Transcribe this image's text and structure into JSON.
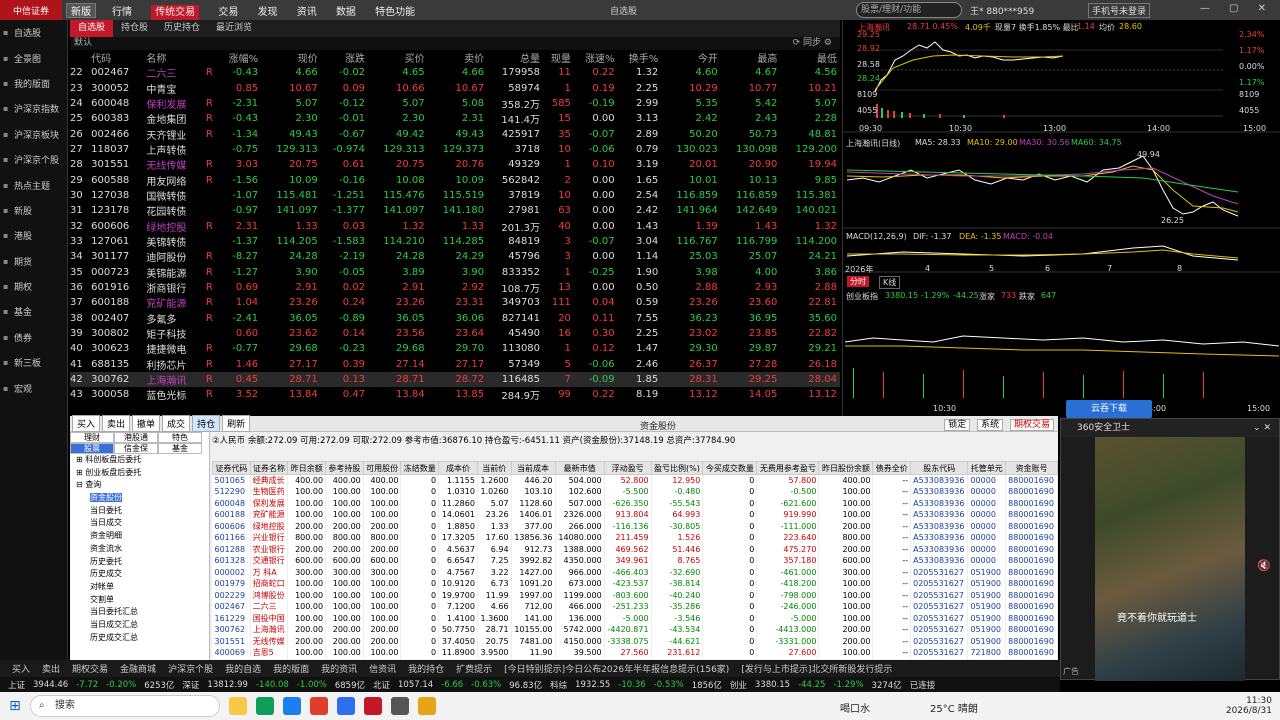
{
  "app": {
    "broker": "中信证券",
    "version_select": "新版",
    "menu": [
      "行情",
      "传统交易",
      "交易",
      "发现",
      "资讯",
      "数据",
      "特色功能"
    ],
    "active_menu": "传统交易",
    "window_title": "自选股",
    "search_placeholder": "股票/理财/功能",
    "user": "王* 880***959",
    "phone_login": "手机号未登录"
  },
  "left_nav": [
    "自选股",
    "全景图",
    "我的版面",
    "沪深京指数",
    "沪深京板块",
    "沪深京个股",
    "热点主题",
    "新股",
    "港股",
    "期货",
    "期权",
    "基金",
    "债券",
    "新三板",
    "宏观"
  ],
  "sub_tabs": [
    "自选股",
    "持仓股",
    "历史持仓",
    "最近浏览"
  ],
  "default_label": "默认",
  "sync_label": "同步",
  "quote_columns": [
    "",
    "代码",
    "名称",
    "",
    "涨幅%",
    "现价",
    "涨跌",
    "买价",
    "卖价",
    "总量",
    "现量",
    "涨速%",
    "换手%",
    "今开",
    "最高",
    "最低"
  ],
  "quotes": [
    [
      "22",
      "002467",
      "二六三",
      "R",
      "-0.43",
      "4.66",
      "-0.02",
      "4.65",
      "4.66",
      "179958",
      "11",
      "0.22",
      "1.32",
      "4.60",
      "4.67",
      "4.56"
    ],
    [
      "23",
      "300052",
      "中青宝",
      "",
      "0.85",
      "10.67",
      "0.09",
      "10.66",
      "10.67",
      "58974",
      "1",
      "0.19",
      "2.25",
      "10.29",
      "10.77",
      "10.21"
    ],
    [
      "24",
      "600048",
      "保利发展",
      "R",
      "-2.31",
      "5.07",
      "-0.12",
      "5.07",
      "5.08",
      "358.2万",
      "585",
      "-0.19",
      "2.99",
      "5.35",
      "5.42",
      "5.07"
    ],
    [
      "25",
      "600383",
      "金地集团",
      "R",
      "-0.43",
      "2.30",
      "-0.01",
      "2.30",
      "2.31",
      "141.4万",
      "15",
      "0.00",
      "3.13",
      "2.42",
      "2.43",
      "2.28"
    ],
    [
      "26",
      "002466",
      "天齐锂业",
      "R",
      "-1.34",
      "49.43",
      "-0.67",
      "49.42",
      "49.43",
      "425917",
      "35",
      "-0.07",
      "2.89",
      "50.20",
      "50.73",
      "48.81"
    ],
    [
      "27",
      "118037",
      "上声转债",
      "",
      "-0.75",
      "129.313",
      "-0.974",
      "129.313",
      "129.373",
      "3718",
      "10",
      "-0.06",
      "0.79",
      "130.023",
      "130.098",
      "129.200"
    ],
    [
      "28",
      "301551",
      "无线传媒",
      "R",
      "3.03",
      "20.75",
      "0.61",
      "20.75",
      "20.76",
      "49329",
      "1",
      "0.10",
      "3.19",
      "20.01",
      "20.90",
      "19.94"
    ],
    [
      "29",
      "600588",
      "用友网络",
      "R",
      "-1.56",
      "10.09",
      "-0.16",
      "10.08",
      "10.09",
      "562842",
      "2",
      "0.00",
      "1.65",
      "10.01",
      "10.13",
      "9.85"
    ],
    [
      "30",
      "127038",
      "国微转债",
      "",
      "-1.07",
      "115.481",
      "-1.251",
      "115.476",
      "115.519",
      "37819",
      "10",
      "0.00",
      "2.54",
      "116.859",
      "116.859",
      "115.381"
    ],
    [
      "31",
      "123178",
      "花园转债",
      "",
      "-0.97",
      "141.097",
      "-1.377",
      "141.097",
      "141.180",
      "27981",
      "63",
      "0.00",
      "2.42",
      "141.964",
      "142.649",
      "140.021"
    ],
    [
      "32",
      "600606",
      "绿地控股",
      "R",
      "2.31",
      "1.33",
      "0.03",
      "1.32",
      "1.33",
      "201.3万",
      "40",
      "0.00",
      "1.43",
      "1.39",
      "1.43",
      "1.32"
    ],
    [
      "33",
      "127061",
      "美锦转债",
      "",
      "-1.37",
      "114.205",
      "-1.583",
      "114.210",
      "114.285",
      "84819",
      "3",
      "-0.07",
      "3.04",
      "116.767",
      "116.799",
      "114.200"
    ],
    [
      "34",
      "301177",
      "迪阿股份",
      "R",
      "-8.27",
      "24.28",
      "-2.19",
      "24.28",
      "24.29",
      "45796",
      "3",
      "0.00",
      "1.14",
      "25.03",
      "25.07",
      "24.21"
    ],
    [
      "35",
      "000723",
      "美锦能源",
      "R",
      "-1.27",
      "3.90",
      "-0.05",
      "3.89",
      "3.90",
      "833352",
      "1",
      "-0.25",
      "1.90",
      "3.98",
      "4.00",
      "3.86"
    ],
    [
      "36",
      "601916",
      "浙商银行",
      "R",
      "0.69",
      "2.91",
      "0.02",
      "2.91",
      "2.92",
      "108.7万",
      "13",
      "0.00",
      "0.50",
      "2.88",
      "2.93",
      "2.88"
    ],
    [
      "37",
      "600188",
      "兖矿能源",
      "R",
      "1.04",
      "23.26",
      "0.24",
      "23.26",
      "23.31",
      "349703",
      "111",
      "0.04",
      "0.59",
      "23.26",
      "23.60",
      "22.81"
    ],
    [
      "38",
      "002407",
      "多氟多",
      "R",
      "-2.41",
      "36.05",
      "-0.89",
      "36.05",
      "36.06",
      "827141",
      "20",
      "0.11",
      "7.55",
      "36.23",
      "36.95",
      "35.60"
    ],
    [
      "39",
      "300802",
      "矩子科技",
      "",
      "0.60",
      "23.62",
      "0.14",
      "23.56",
      "23.64",
      "45490",
      "16",
      "0.30",
      "2.25",
      "23.02",
      "23.85",
      "22.82"
    ],
    [
      "40",
      "300623",
      "捷捷微电",
      "R",
      "-0.77",
      "29.68",
      "-0.23",
      "29.68",
      "29.70",
      "113080",
      "1",
      "0.12",
      "1.47",
      "29.30",
      "29.87",
      "29.21"
    ],
    [
      "41",
      "688135",
      "利扬芯片",
      "R",
      "1.46",
      "27.17",
      "0.39",
      "27.14",
      "27.17",
      "57349",
      "5",
      "-0.06",
      "2.46",
      "26.37",
      "27.28",
      "26.18"
    ],
    [
      "42",
      "300762",
      "上海瀚讯",
      "R",
      "0.45",
      "28.71",
      "0.13",
      "28.71",
      "28.72",
      "116485",
      "7",
      "-0.09",
      "1.85",
      "28.31",
      "29.25",
      "28.04"
    ],
    [
      "43",
      "300058",
      "蓝色光标",
      "R",
      "3.52",
      "13.84",
      "0.47",
      "13.84",
      "13.85",
      "284.9万",
      "99",
      "0.22",
      "8.19",
      "13.12",
      "14.05",
      "13.12"
    ]
  ],
  "quote_colors": {
    "name_colors": [
      "p",
      "w",
      "p",
      "w",
      "w",
      "w",
      "p",
      "w",
      "w",
      "w",
      "p",
      "w",
      "w",
      "w",
      "w",
      "p",
      "w",
      "w",
      "w",
      "w",
      "p",
      "w"
    ]
  },
  "chart": {
    "intraday": {
      "stock_name": "上海瀚讯",
      "price_label": "28.71 0.45%",
      "volume_label": "4.09千",
      "turnover_label": "现量7 换手1.85% 最比",
      "ratio": "1.14",
      "avg_label": "均价",
      "avg_value": "28.60",
      "left_ticks": [
        "29.25",
        "28.92",
        "28.58",
        "28.24",
        "8109",
        "4055"
      ],
      "right_ticks": [
        "2.34%",
        "1.17%",
        "0.00%",
        "1.17%",
        "8109",
        "4055"
      ],
      "time_ticks": [
        "09:30",
        "10:30",
        "13:00",
        "14:00",
        "15:00"
      ]
    },
    "daily": {
      "title": "上海瀚讯(日线)",
      "ma5": "MA5: 28.33",
      "ma10": "MA10: 29.00",
      "ma30": "MA30: 30.56",
      "ma60": "MA60: 34.75",
      "high_label": "49.94",
      "low_label": "26.25",
      "macd": "MACD(12,26,9)",
      "dif": "DIF: -1.37",
      "dea": "DEA: -1.35",
      "macd_val": "MACD: -0.04",
      "x_ticks": [
        "2026年",
        "4",
        "5",
        "6",
        "7",
        "8"
      ]
    },
    "index": {
      "tabs": [
        "分时",
        "K线"
      ],
      "name": "创业板指",
      "value": "3380.15",
      "pct": "-1.29%",
      "chg": "-44.25",
      "up_label": "涨家",
      "up": "733",
      "down_label": "跌家",
      "down": "647",
      "time_ticks": [
        "10:30",
        "14:00",
        "15:00"
      ]
    }
  },
  "bottom": {
    "toolbar": [
      "买入",
      "卖出",
      "撤单",
      "成交",
      "持仓",
      "刷新"
    ],
    "active_tool": "持仓",
    "title": "资金股份",
    "right_buttons": [
      "锁定",
      "系统",
      "期权交易"
    ],
    "tree_tabs": [
      "理财",
      "港股通",
      "特色",
      "股票",
      "信金保",
      "基金"
    ],
    "tree_items": [
      "科创板盘后委托",
      "创业板盘后委托",
      "查询"
    ],
    "tree_sub": [
      "资金股份",
      "当日委托",
      "当日成交",
      "资金明细",
      "资金流水",
      "历史委托",
      "历史成交",
      "对帐单",
      "交割单",
      "当日委托汇总",
      "当日成交汇总",
      "历史成交汇总"
    ],
    "acct_line": "②人民币    余额:272.09   可用:272.09   可取:272.09   参考市值:36876.10   持仓盈亏:-6451.11   资产(资金股份):37148.19        总资产:37784.90",
    "pos_columns": [
      "证券代码",
      "证券名称",
      "昨日余额",
      "参考持股",
      "可用股份",
      "冻结数量",
      "成本价",
      "当前价",
      "当前成本",
      "最新市值",
      "浮动盈亏",
      "盈亏比例(%)",
      "今买成交数量",
      "无费用参考盈亏",
      "昨日股份余额",
      "债券全价",
      "股东代码",
      "托管单元",
      "资金账号"
    ],
    "positions": [
      [
        "501065",
        "经典成长",
        "400.00",
        "400.00",
        "400.00",
        "0",
        "1.1155",
        "1.2600",
        "446.20",
        "504.000",
        "52.800",
        "12.950",
        "0",
        "57.800",
        "400.00",
        "--",
        "A533083936",
        "00000",
        "880001690"
      ],
      [
        "512290",
        "生物医药",
        "100.00",
        "100.00",
        "100.00",
        "0",
        "1.0310",
        "1.0260",
        "103.10",
        "102.600",
        "-5.500",
        "-0.480",
        "0",
        "-0.500",
        "100.00",
        "--",
        "A533083936",
        "00000",
        "880001690"
      ],
      [
        "600048",
        "保利发展",
        "100.00",
        "100.00",
        "100.00",
        "0",
        "11.2860",
        "5.07",
        "1128.60",
        "507.000",
        "-626.350",
        "-55.543",
        "0",
        "-621.600",
        "100.00",
        "--",
        "A533083936",
        "00000",
        "880001690"
      ],
      [
        "600188",
        "兖矿能源",
        "100.00",
        "100.00",
        "100.00",
        "0",
        "14.0601",
        "23.26",
        "1406.01",
        "2326.000",
        "913.804",
        "64.993",
        "0",
        "919.990",
        "100.00",
        "--",
        "A533083936",
        "00000",
        "880001690"
      ],
      [
        "600606",
        "绿地控股",
        "200.00",
        "200.00",
        "200.00",
        "0",
        "1.8850",
        "1.33",
        "377.00",
        "266.000",
        "-116.136",
        "-30.805",
        "0",
        "-111.000",
        "200.00",
        "--",
        "A533083936",
        "00000",
        "880001690"
      ],
      [
        "601166",
        "兴业银行",
        "800.00",
        "800.00",
        "800.00",
        "0",
        "17.3205",
        "17.60",
        "13856.36",
        "14080.000",
        "211.459",
        "1.526",
        "0",
        "223.640",
        "800.00",
        "--",
        "A533083936",
        "00000",
        "880001690"
      ],
      [
        "601288",
        "农业银行",
        "200.00",
        "200.00",
        "200.00",
        "0",
        "4.5637",
        "6.94",
        "912.73",
        "1388.000",
        "469.562",
        "51.446",
        "0",
        "475.270",
        "200.00",
        "--",
        "A533083936",
        "00000",
        "880001690"
      ],
      [
        "601328",
        "交通银行",
        "600.00",
        "600.00",
        "600.00",
        "0",
        "6.6547",
        "7.25",
        "3992.82",
        "4350.000",
        "349.961",
        "8.765",
        "0",
        "357.180",
        "600.00",
        "--",
        "A533083936",
        "00000",
        "880001690"
      ],
      [
        "000002",
        "万 科A",
        "300.00",
        "300.00",
        "300.00",
        "0",
        "4.7567",
        "3.22",
        "1427.00",
        "966.000",
        "-466.403",
        "-32.690",
        "0",
        "-461.000",
        "300.00",
        "--",
        "0205531627",
        "051900",
        "880001690"
      ],
      [
        "001979",
        "招商蛇口",
        "100.00",
        "100.00",
        "100.00",
        "0",
        "10.9120",
        "6.73",
        "1091.20",
        "673.000",
        "-423.537",
        "-38.814",
        "0",
        "-418.200",
        "100.00",
        "--",
        "0205531627",
        "051900",
        "880001690"
      ],
      [
        "002229",
        "鸿博股份",
        "100.00",
        "100.00",
        "100.00",
        "0",
        "19.9700",
        "11.99",
        "1997.00",
        "1199.000",
        "-803.600",
        "-40.240",
        "0",
        "-798.000",
        "100.00",
        "--",
        "0205531627",
        "051900",
        "880001690"
      ],
      [
        "002467",
        "二六三",
        "100.00",
        "100.00",
        "100.00",
        "0",
        "7.1200",
        "4.66",
        "712.00",
        "466.000",
        "-251.233",
        "-35.286",
        "0",
        "-246.000",
        "100.00",
        "--",
        "0205531627",
        "051900",
        "880001690"
      ],
      [
        "161229",
        "国投中国",
        "100.00",
        "100.00",
        "100.00",
        "0",
        "1.4100",
        "1.3600",
        "141.00",
        "136.000",
        "-5.000",
        "-3.546",
        "0",
        "-5.000",
        "100.00",
        "--",
        "0205531627",
        "051900",
        "880001690"
      ],
      [
        "300762",
        "上海瀚讯",
        "200.00",
        "200.00",
        "200.00",
        "0",
        "50.7750",
        "28.71",
        "10155.00",
        "5742.000",
        "-4420.871",
        "-43.534",
        "0",
        "-4413.000",
        "200.00",
        "--",
        "0205531627",
        "051900",
        "880001690"
      ],
      [
        "301551",
        "无线传媒",
        "200.00",
        "200.00",
        "200.00",
        "0",
        "37.4050",
        "20.75",
        "7481.00",
        "4150.000",
        "-3338.075",
        "-44.621",
        "0",
        "-3331.000",
        "200.00",
        "--",
        "0205531627",
        "051900",
        "880001690"
      ],
      [
        "400069",
        "吉恩5",
        "100.00",
        "100.00",
        "100.00",
        "0",
        "11.8900",
        "3.9500",
        "11.90",
        "39.500",
        "27.560",
        "231.612",
        "0",
        "27.600",
        "100.00",
        "--",
        "0205531627",
        "721800",
        "880001690"
      ]
    ]
  },
  "video": {
    "title": "360安全卫士",
    "subtitle": "竟不着你就玩道士",
    "ad": "广告",
    "download": "云吞下载"
  },
  "funcbar": [
    "买入",
    "卖出",
    "期权交易",
    "金融商城",
    "沪深京个股",
    "我的自选",
    "我的版面",
    "我的资讯",
    "信资讯",
    "我的持仓",
    "扩费提示",
    "[今日特别提示]今日公布2026年半年报信息提示(156家)",
    "[发行与上市提示]北交所新股发行提示"
  ],
  "ticker": [
    "上证",
    "3944.46",
    "-7.72",
    "-0.20%",
    "6253亿",
    "深证",
    "13812.99",
    "-140.08",
    "-1.00%",
    "6859亿",
    "北证",
    "1057.14",
    "-6.66",
    "-0.63%",
    "96.83亿",
    "科综",
    "1932.55",
    "-10.36",
    "-0.53%",
    "1856亿",
    "创业",
    "3380.15",
    "-44.25",
    "-1.29%",
    "3274亿",
    "已连接"
  ],
  "taskbar": {
    "search": "搜索",
    "drink": "喝口水",
    "weather": "25°C 晴朗",
    "time": "11:30",
    "date": "2026/8/31"
  }
}
